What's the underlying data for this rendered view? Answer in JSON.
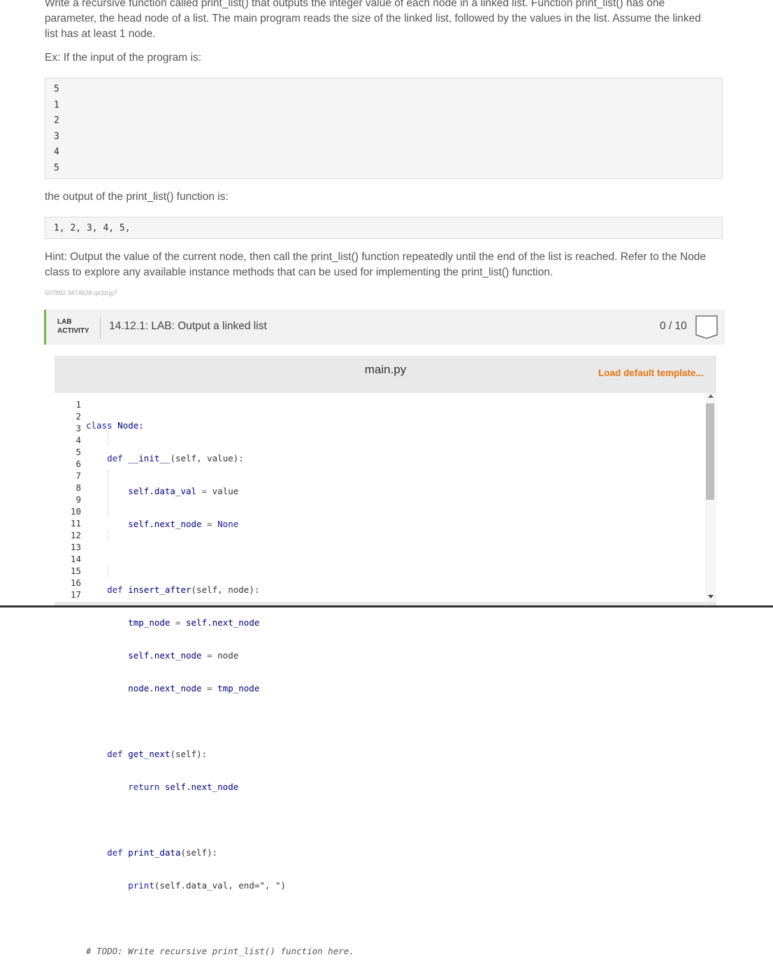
{
  "instructions": {
    "p1": "Write a recursive function called print_list() that outputs the integer value of each node in a linked list. Function print_list() has one parameter, the head node of a list. The main program reads the size of the linked list, followed by the values in the list. Assume the linked list has at least 1 node.",
    "p2": "Ex: If the input of the program is:",
    "input_lines": [
      "5",
      "1",
      "2",
      "3",
      "4",
      "5"
    ],
    "p3": "the output of the print_list() function is:",
    "output_text": "1, 2, 3, 4, 5,",
    "p4": "Hint: Output the value of the current node, then call the print_list() function repeatedly until the end of the list is reached. Refer to the Node class to explore any available instance methods that can be used for implementing the print_list() function.",
    "hash": "507892.3474628.qx3zqy7"
  },
  "lab": {
    "tag_line1": "LAB",
    "tag_line2": "ACTIVITY",
    "title": "14.12.1: LAB: Output a linked list",
    "score": "0 / 10",
    "accent_color": "#7cb342"
  },
  "editor": {
    "file_name": "main.py",
    "load_template": "Load default template...",
    "load_color": "#e87511",
    "line_numbers": [
      "1",
      "2",
      "3",
      "4",
      "5",
      "6",
      "7",
      "8",
      "9",
      "10",
      "11",
      "12",
      "13",
      "14",
      "15",
      "16",
      "17"
    ],
    "code": {
      "l1_kw": "class",
      "l1_name": "Node:",
      "l2_kw": "def",
      "l2_name": "__init__",
      "l2_rest": "(self, value):",
      "l3_a": "self.data_val",
      "l3_op": " = ",
      "l3_b": "value",
      "l4_a": "self.next_node",
      "l4_op": " = ",
      "l4_b": "None",
      "l6_kw": "def",
      "l6_name": "insert_after",
      "l6_rest": "(self, node):",
      "l7_a": "tmp_node",
      "l7_op": " = ",
      "l7_b": "self.next_node",
      "l8_a": "self.next_node",
      "l8_op": " = ",
      "l8_b": "node",
      "l9_a": "node.next_node",
      "l9_op": " = ",
      "l9_b": "tmp_node",
      "l11_kw": "def",
      "l11_name": "get_next",
      "l11_rest": "(self):",
      "l12_kw": "return",
      "l12_rest": " self.next_node",
      "l14_kw": "def",
      "l14_name": "print_data",
      "l14_rest": "(self):",
      "l15_fn": "print",
      "l15_rest": "(self.data_val, end=\", \")",
      "l17_comment": "# TODO: Write recursive print_list() function here."
    }
  }
}
